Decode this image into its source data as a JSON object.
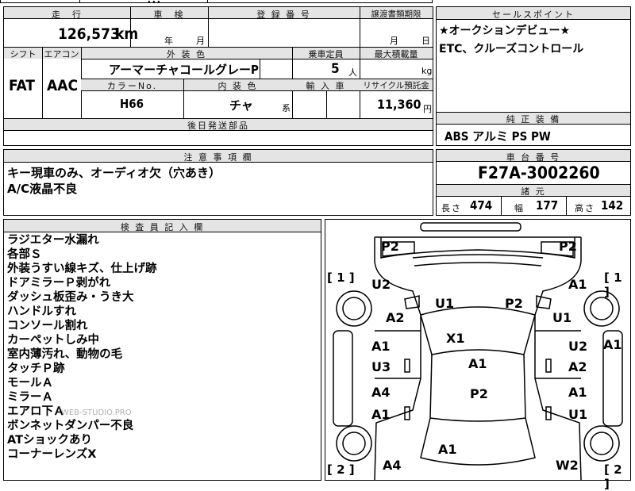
{
  "top_strip": {
    "fragment": "．．．"
  },
  "mileage": {
    "header": "走　行",
    "value": "126,573",
    "unit": "km"
  },
  "inspection": {
    "header": "車　検",
    "year_unit": "年",
    "month_unit": "月"
  },
  "registration": {
    "header": "登 録 番 号",
    "value": ""
  },
  "transfer_deadline": {
    "header": "譲渡書類期限",
    "month_unit": "月",
    "day_unit": "日"
  },
  "shift": {
    "header": "シフト",
    "value": "FAT"
  },
  "aircon": {
    "header": "エアコン",
    "value": "AAC"
  },
  "exterior_color": {
    "header": "外 装 色",
    "value": "アーマーチャコールグレーP"
  },
  "capacity": {
    "header": "乗車定員",
    "value": "5",
    "unit": "人"
  },
  "max_load": {
    "header": "最大積載量",
    "unit": "kg"
  },
  "color_no": {
    "header": "カラーNo.",
    "value": "H66"
  },
  "interior_color": {
    "header": "内 装 色",
    "value": "チャ",
    "suffix": "系"
  },
  "import_car": {
    "header": "輸 入 車"
  },
  "recycle": {
    "header": "リサイクル預託金",
    "value": "11,360",
    "unit": "円"
  },
  "later_parts": {
    "header": "後日発送部品"
  },
  "sales_points": {
    "header": "セールスポイント",
    "lines": [
      "★オークションデビュー★",
      "ETC、クルーズコントロール"
    ]
  },
  "standard_equipment": {
    "header": "純 正 装 備",
    "value": "ABS アルミ PS PW"
  },
  "cautions": {
    "header": "注 意 事 項 欄",
    "lines": [
      "キー現車のみ、オーディオ欠（穴あき）",
      "A/C液晶不良"
    ]
  },
  "chassis": {
    "header": "車 台 番 号",
    "value": "F27A-3002260"
  },
  "specs": {
    "header": "諸 元",
    "length_label": "長さ",
    "length": "474",
    "width_label": "幅",
    "width": "177",
    "height_label": "高さ",
    "height": "142"
  },
  "inspector_notes": {
    "header": "検 査 員 記 入 欄",
    "lines": [
      "ラジエター水漏れ",
      "各部Ｓ",
      "外装うすい線キズ、仕上げ跡",
      "ドアミラーＰ剥がれ",
      "ダッシュ板歪み・うき大",
      "ハンドルすれ",
      "コンソール割れ",
      "カーペットしみ中",
      "室内薄汚れ、動物の毛",
      "タッチＰ跡",
      "モールＡ",
      "ミラーＡ",
      "エアロ下Ａ",
      "ボンネットダンパー不良",
      "ATショックあり",
      "コーナーレンズX"
    ],
    "watermark": "WEB-STUDIO.PRO"
  },
  "diagram": {
    "brackets": [
      "[ 1 ]",
      "[ 1 ]",
      "[ 2 ]",
      "[ 2 ]"
    ],
    "marks": [
      "P2",
      "P2",
      "U2",
      "A1",
      "U1",
      "P2",
      "A2",
      "U1",
      "X1",
      "A1",
      "A1",
      "U2",
      "A1",
      "U3",
      "A2",
      "A1",
      "A4",
      "A1",
      "P2",
      "B1",
      "U1",
      "A1",
      "A4",
      "W2"
    ]
  }
}
